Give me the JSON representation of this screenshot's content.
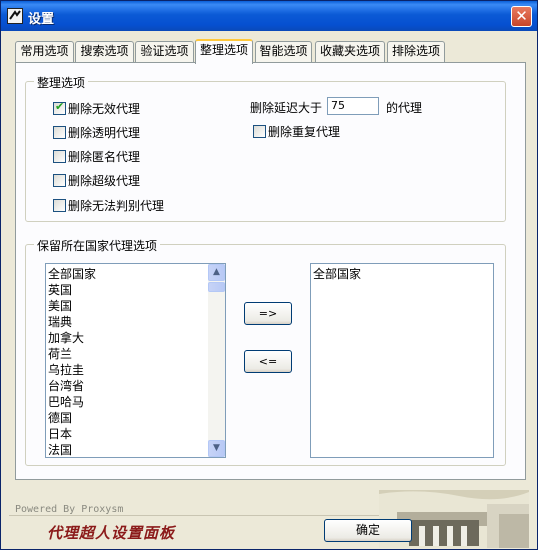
{
  "window": {
    "title": "设置",
    "close": "✕"
  },
  "tabs": [
    {
      "label": "常用选项",
      "active": false
    },
    {
      "label": "搜索选项",
      "active": false
    },
    {
      "label": "验证选项",
      "active": false
    },
    {
      "label": "整理选项",
      "active": true
    },
    {
      "label": "智能选项",
      "active": false
    },
    {
      "label": "收藏夹选项",
      "active": false
    },
    {
      "label": "排除选项",
      "active": false
    }
  ],
  "cleanup": {
    "legend": "整理选项",
    "remove_invalid": {
      "label": "删除无效代理",
      "checked": true
    },
    "remove_transparent": {
      "label": "删除透明代理",
      "checked": false
    },
    "remove_anonymous": {
      "label": "删除匿名代理",
      "checked": false
    },
    "remove_super": {
      "label": "删除超级代理",
      "checked": false
    },
    "remove_unknown": {
      "label": "删除无法判别代理",
      "checked": false
    },
    "delay_prefix": "删除延迟大于",
    "delay_value": "75",
    "delay_suffix": "的代理",
    "remove_duplicate": {
      "label": "删除重复代理",
      "checked": false
    }
  },
  "countries": {
    "legend": "保留所在国家代理选项",
    "available": [
      "全部国家",
      "英国",
      "美国",
      "瑞典",
      "加拿大",
      "荷兰",
      "乌拉圭",
      "台湾省",
      "巴哈马",
      "德国",
      "日本",
      "法国"
    ],
    "selected": [
      "全部国家"
    ],
    "add_button": "=>",
    "remove_button": "<="
  },
  "footer": {
    "powered": "Powered By Proxysm",
    "title": "代理超人设置面板",
    "ok_button": "确定"
  }
}
